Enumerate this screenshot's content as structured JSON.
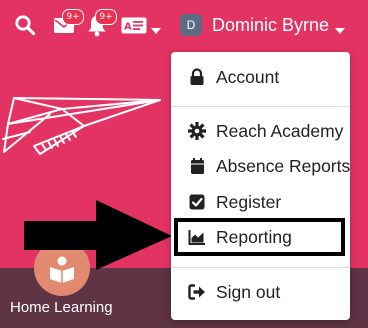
{
  "header": {
    "messages_badge": "9+",
    "notifications_badge": "9+",
    "user": {
      "initial": "D",
      "name": "Dominic Byrne"
    }
  },
  "menu": {
    "items": [
      {
        "label": "Account",
        "icon": "lock-icon"
      },
      {
        "label": "Reach Academy",
        "icon": "gear-icon"
      },
      {
        "label": "Absence Reports",
        "icon": "calendar-icon"
      },
      {
        "label": "Register",
        "icon": "checkbox-icon"
      },
      {
        "label": "Reporting",
        "icon": "area-chart-icon",
        "highlighted": true
      },
      {
        "label": "Sign out",
        "icon": "sign-out-icon"
      }
    ]
  },
  "tiles": [
    {
      "label": "Home Learning",
      "icon": "book-reader-icon"
    }
  ],
  "colors": {
    "background": "#e23363",
    "bottom_strip": "#5e3344",
    "badge": "#e8314f",
    "highlight_border": "#000000"
  }
}
